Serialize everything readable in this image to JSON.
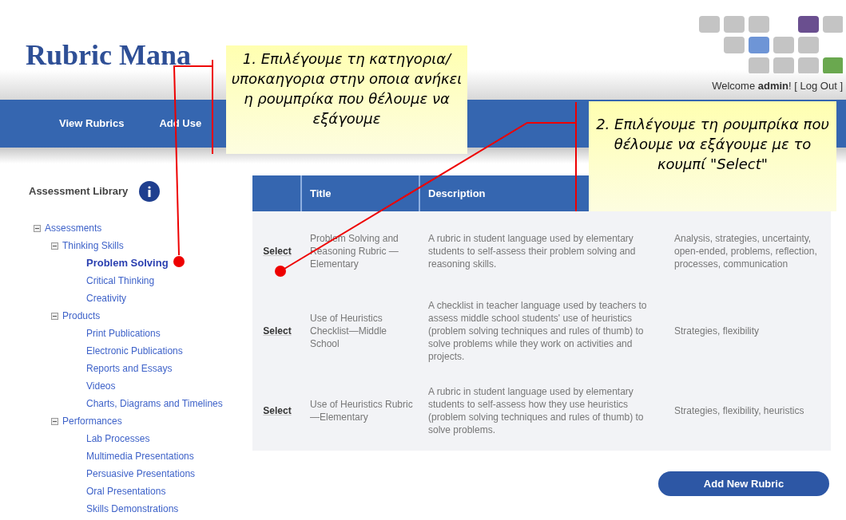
{
  "header": {
    "title": "Rubric Mana",
    "welcome": "Welcome **admin**! [ Log Out ]"
  },
  "nav": [
    {
      "label": "View Rubrics"
    },
    {
      "label": "Add Use"
    }
  ],
  "sidebar": {
    "title": "Assessment Library",
    "tree": [
      {
        "label": "Assessments",
        "expanded": true,
        "selected": false,
        "children": [
          {
            "label": "Thinking Skills",
            "expanded": true,
            "selected": false,
            "children": [
              {
                "label": "Problem Solving",
                "selected": true
              },
              {
                "label": "Critical Thinking",
                "selected": false
              },
              {
                "label": "Creativity",
                "selected": false
              }
            ]
          },
          {
            "label": "Products",
            "expanded": true,
            "selected": false,
            "children": [
              {
                "label": "Print Publications",
                "selected": false
              },
              {
                "label": "Electronic Publications",
                "selected": false
              },
              {
                "label": "Reports and Essays",
                "selected": false
              },
              {
                "label": "Videos",
                "selected": false
              },
              {
                "label": "Charts, Diagrams and Timelines",
                "selected": false
              }
            ]
          },
          {
            "label": "Performances",
            "expanded": true,
            "selected": false,
            "children": [
              {
                "label": "Lab Processes",
                "selected": false
              },
              {
                "label": "Multimedia Presentations",
                "selected": false
              },
              {
                "label": "Persuasive Presentations",
                "selected": false
              },
              {
                "label": "Oral Presentations",
                "selected": false
              },
              {
                "label": "Skills Demonstrations",
                "selected": false
              }
            ]
          }
        ]
      }
    ]
  },
  "table": {
    "columns": [
      "Title",
      "Description"
    ],
    "rows": [
      {
        "action": "Select",
        "title": "Problem Solving and Reasoning Rubric —Elementary",
        "description": "A rubric in student language used by elementary students to self-assess their problem solving and reasoning skills.",
        "keywords": "Analysis, strategies, uncertainty, open-ended, problems, reflection, processes, communication"
      },
      {
        "action": "Select",
        "title": "Use of Heuristics Checklist—Middle School",
        "description": "A checklist in teacher language used by teachers to assess middle school students' use of heuristics (problem solving techniques and rules of thumb) to solve problems while they work on activities and projects.",
        "keywords": "Strategies, flexibility"
      },
      {
        "action": "Select",
        "title": "Use of Heuristics Rubric —Elementary",
        "description": "A rubric in student language used by elementary students to self-assess how they use heuristics (problem solving techniques and rules of thumb) to solve problems.",
        "keywords": "Strategies, flexibility, heuristics"
      }
    ]
  },
  "add_button": "Add New Rubric",
  "annotations": [
    {
      "text": "1. Επιλέγουμε τη κατηγορια/υποκαηγορια στην οποια ανήκει η ρουμπρίκα που θέλουμε να εξάγουμε"
    },
    {
      "text": "2. Επιλέγουμε τη ρουμπρίκα που θέλουμε να εξάγουμε με το κουμπί \"Select\""
    }
  ]
}
